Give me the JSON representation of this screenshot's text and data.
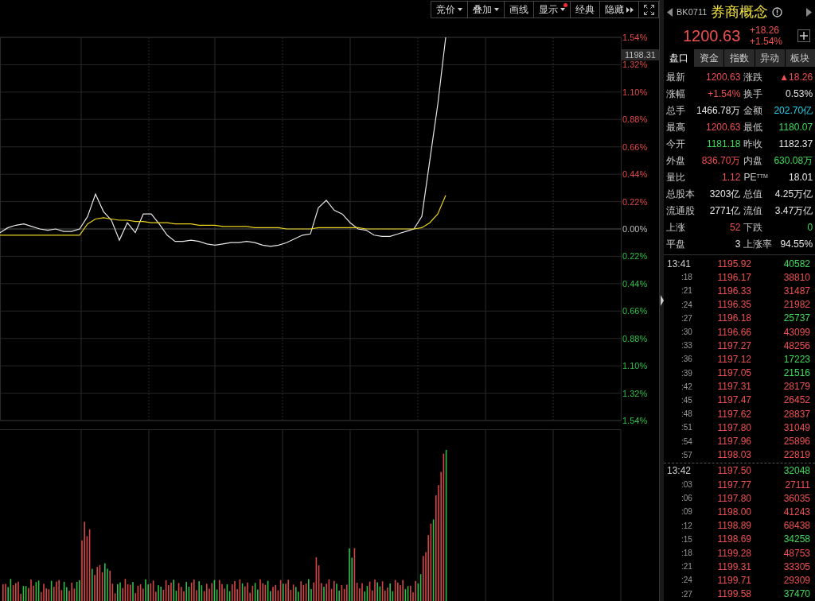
{
  "toolbar": [
    {
      "label": "竞价",
      "dropdown": true,
      "dot": false
    },
    {
      "label": "叠加",
      "dropdown": true,
      "dot": false
    },
    {
      "label": "画线",
      "dropdown": false,
      "dot": false
    },
    {
      "label": "显示",
      "dropdown": true,
      "dot": true
    },
    {
      "label": "经典",
      "dropdown": false,
      "dot": false
    },
    {
      "label": "隐藏",
      "dropdown": false,
      "dot": false,
      "more": true
    }
  ],
  "price_chart": {
    "cursor_price": "1198.31",
    "chart_data": {
      "type": "line",
      "grid": true,
      "ylim": [
        -1.54,
        1.54
      ],
      "yticks": [
        {
          "value": 1.54,
          "label": "1.54%"
        },
        {
          "value": 1.32,
          "label": "1.32%"
        },
        {
          "value": 1.1,
          "label": "1.10%"
        },
        {
          "value": 0.88,
          "label": "0.88%"
        },
        {
          "value": 0.66,
          "label": "0.66%"
        },
        {
          "value": 0.44,
          "label": "0.44%"
        },
        {
          "value": 0.22,
          "label": "0.22%"
        },
        {
          "value": 0,
          "label": "0.00%"
        },
        {
          "value": -0.22,
          "label": "0.22%"
        },
        {
          "value": -0.44,
          "label": "0.44%"
        },
        {
          "value": -0.66,
          "label": "0.66%"
        },
        {
          "value": -0.88,
          "label": "0.88%"
        },
        {
          "value": -1.1,
          "label": "1.10%"
        },
        {
          "value": -1.32,
          "label": "1.32%"
        },
        {
          "value": -1.54,
          "label": "1.54%"
        }
      ],
      "series": [
        {
          "color": "#e6e6e6",
          "values": [
            -0.03,
            0.01,
            0.03,
            0.04,
            0.02,
            0.0,
            -0.01,
            0.0,
            -0.02,
            -0.02,
            0.0,
            0.1,
            0.28,
            0.14,
            0.07,
            -0.09,
            0.05,
            -0.03,
            0.12,
            0.12,
            0.04,
            -0.05,
            -0.1,
            -0.1,
            -0.09,
            -0.1,
            -0.12,
            -0.13,
            -0.12,
            -0.11,
            -0.11,
            -0.1,
            -0.11,
            -0.13,
            -0.14,
            -0.13,
            -0.11,
            -0.08,
            -0.05,
            -0.04,
            0.17,
            0.23,
            0.15,
            0.12,
            0.05,
            0.0,
            -0.01,
            -0.05,
            -0.06,
            -0.06,
            -0.04,
            -0.02,
            0.0,
            0.1,
            0.55,
            1.0,
            1.54
          ]
        },
        {
          "color": "#e8d21c",
          "values": [
            -0.05,
            -0.05,
            -0.05,
            -0.05,
            -0.05,
            -0.05,
            -0.05,
            -0.05,
            -0.05,
            -0.05,
            -0.05,
            0.04,
            0.08,
            0.09,
            0.08,
            0.07,
            0.07,
            0.06,
            0.06,
            0.05,
            0.05,
            0.05,
            0.04,
            0.04,
            0.04,
            0.03,
            0.03,
            0.03,
            0.02,
            0.02,
            0.02,
            0.02,
            0.01,
            0.01,
            0.01,
            0.01,
            0.0,
            0.0,
            0.0,
            0.0,
            0.01,
            0.01,
            0.01,
            0.01,
            0.01,
            0.01,
            0.0,
            0.0,
            0.0,
            0.0,
            0.0,
            0.0,
            0.0,
            0.01,
            0.05,
            0.12,
            0.27
          ]
        }
      ]
    }
  },
  "quote": {
    "code": "BK0711",
    "name": "券商概念",
    "price": "1200.63",
    "change": "+18.26",
    "change_pct": "+1.54%"
  },
  "tabs": [
    {
      "label": "盘口",
      "selected": true
    },
    {
      "label": "资金",
      "selected": false
    },
    {
      "label": "指数",
      "selected": false
    },
    {
      "label": "异动",
      "selected": false
    },
    {
      "label": "板块",
      "selected": false
    }
  ],
  "stats": [
    [
      {
        "label": "最新",
        "value": "1200.63",
        "color": "#f05050"
      },
      {
        "label": "涨跌",
        "value": "▲18.26",
        "color": "#f05050"
      }
    ],
    [
      {
        "label": "涨幅",
        "value": "+1.54%",
        "color": "#f05050"
      },
      {
        "label": "换手",
        "value": "0.53%",
        "color": "#e6e6e6"
      }
    ],
    [
      {
        "label": "总手",
        "value": "1466.78万",
        "color": "#e6e6e6"
      },
      {
        "label": "金额",
        "value": "202.70亿",
        "color": "#22d3ee"
      }
    ],
    [
      {
        "label": "最高",
        "value": "1200.63",
        "color": "#f05050"
      },
      {
        "label": "最低",
        "value": "1180.07",
        "color": "#3ddc5a"
      }
    ],
    [
      {
        "label": "今开",
        "value": "1181.18",
        "color": "#3ddc5a"
      },
      {
        "label": "昨收",
        "value": "1182.37",
        "color": "#e6e6e6"
      }
    ],
    [
      {
        "label": "外盘",
        "value": "836.70万",
        "color": "#f05050"
      },
      {
        "label": "内盘",
        "value": "630.08万",
        "color": "#3ddc5a"
      }
    ],
    [
      {
        "label": "量比",
        "value": "1.12",
        "color": "#f05050"
      },
      {
        "label": "PE$^{TTM}$",
        "value": "18.01",
        "color": "#e6e6e6"
      }
    ],
    [
      {
        "label": "总股本",
        "value": "3203亿",
        "color": "#e6e6e6"
      },
      {
        "label": "总值",
        "value": "4.25万亿",
        "color": "#e6e6e6"
      }
    ],
    [
      {
        "label": "流通股",
        "value": "2771亿",
        "color": "#e6e6e6"
      },
      {
        "label": "流值",
        "value": "3.47万亿",
        "color": "#e6e6e6"
      }
    ],
    [
      {
        "label": "上涨",
        "value": "52",
        "color": "#f05050"
      },
      {
        "label": "下跌",
        "value": "0",
        "color": "#3ddc5a"
      }
    ],
    [
      {
        "label": "平盘",
        "value": "3",
        "color": "#e6e6e6"
      },
      {
        "label": "上涨率",
        "value": "94.55%",
        "color": "#e6e6e6"
      }
    ]
  ],
  "ticks": [
    {
      "rows": [
        {
          "kind": "minute",
          "time": "13:41",
          "price": "1195.92",
          "volume": "40582",
          "color": "#3ddc5a"
        },
        {
          "kind": "tick",
          "time": ":18",
          "price": "1196.17",
          "volume": "38810",
          "color": "#f05050"
        },
        {
          "kind": "tick",
          "time": ":21",
          "price": "1196.33",
          "volume": "31487",
          "color": "#f05050"
        },
        {
          "kind": "tick",
          "time": ":24",
          "price": "1196.35",
          "volume": "21982",
          "color": "#f05050"
        },
        {
          "kind": "tick",
          "time": ":27",
          "price": "1196.18",
          "volume": "25737",
          "color": "#3ddc5a"
        },
        {
          "kind": "tick",
          "time": ":30",
          "price": "1196.66",
          "volume": "43099",
          "color": "#f05050"
        },
        {
          "kind": "tick",
          "time": ":33",
          "price": "1197.27",
          "volume": "48256",
          "color": "#f05050"
        },
        {
          "kind": "tick",
          "time": ":36",
          "price": "1197.12",
          "volume": "17223",
          "color": "#3ddc5a"
        },
        {
          "kind": "tick",
          "time": ":39",
          "price": "1197.05",
          "volume": "21516",
          "color": "#3ddc5a"
        },
        {
          "kind": "tick",
          "time": ":42",
          "price": "1197.31",
          "volume": "28179",
          "color": "#f05050"
        },
        {
          "kind": "tick",
          "time": ":45",
          "price": "1197.47",
          "volume": "26452",
          "color": "#f05050"
        },
        {
          "kind": "tick",
          "time": ":48",
          "price": "1197.62",
          "volume": "28837",
          "color": "#f05050"
        },
        {
          "kind": "tick",
          "time": ":51",
          "price": "1197.80",
          "volume": "31049",
          "color": "#f05050"
        },
        {
          "kind": "tick",
          "time": ":54",
          "price": "1197.96",
          "volume": "25896",
          "color": "#f05050"
        },
        {
          "kind": "tick",
          "time": ":57",
          "price": "1198.03",
          "volume": "22819",
          "color": "#f05050"
        }
      ]
    },
    {
      "rows": [
        {
          "kind": "minute",
          "time": "13:42",
          "price": "1197.50",
          "volume": "32048",
          "color": "#3ddc5a"
        },
        {
          "kind": "tick",
          "time": ":03",
          "price": "1197.77",
          "volume": "27111",
          "color": "#f05050"
        },
        {
          "kind": "tick",
          "time": ":06",
          "price": "1197.80",
          "volume": "36035",
          "color": "#f05050"
        },
        {
          "kind": "tick",
          "time": ":09",
          "price": "1198.00",
          "volume": "41243",
          "color": "#f05050"
        },
        {
          "kind": "tick",
          "time": ":12",
          "price": "1198.89",
          "volume": "68438",
          "color": "#f05050"
        },
        {
          "kind": "tick",
          "time": ":15",
          "price": "1198.69",
          "volume": "34258",
          "color": "#3ddc5a"
        },
        {
          "kind": "tick",
          "time": ":18",
          "price": "1199.28",
          "volume": "48753",
          "color": "#f05050"
        },
        {
          "kind": "tick",
          "time": ":21",
          "price": "1199.31",
          "volume": "33305",
          "color": "#f05050"
        },
        {
          "kind": "tick",
          "time": ":24",
          "price": "1199.71",
          "volume": "29309",
          "color": "#f05050"
        },
        {
          "kind": "tick",
          "time": ":27",
          "price": "1199.58",
          "volume": "37470",
          "color": "#3ddc5a"
        }
      ]
    }
  ]
}
